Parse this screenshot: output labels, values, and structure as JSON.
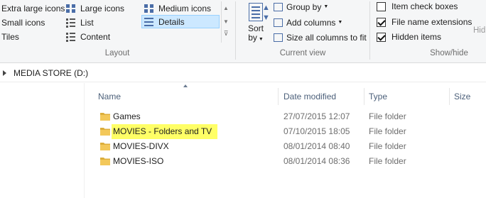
{
  "ribbon": {
    "layout": {
      "label": "Layout",
      "items": [
        {
          "label": "Extra large icons",
          "icon": "extra-large-icons-icon"
        },
        {
          "label": "Large icons",
          "icon": "large-icons-icon"
        },
        {
          "label": "Medium icons",
          "icon": "medium-icons-icon"
        },
        {
          "label": "Small icons",
          "icon": "small-icons-icon"
        },
        {
          "label": "List",
          "icon": "list-icon"
        },
        {
          "label": "Details",
          "icon": "details-icon",
          "selected": true
        },
        {
          "label": "Tiles",
          "icon": "tiles-icon"
        },
        {
          "label": "Content",
          "icon": "content-icon"
        }
      ]
    },
    "current_view": {
      "label": "Current view",
      "sort_by_line1": "Sort",
      "sort_by_line2": "by",
      "group_by": "Group by",
      "add_columns": "Add columns",
      "size_all_columns": "Size all columns to fit"
    },
    "show_hide": {
      "label": "Show/hide",
      "item_check_boxes": {
        "label": "Item check boxes",
        "checked": false
      },
      "file_name_extensions": {
        "label": "File name extensions",
        "checked": true
      },
      "hidden_items": {
        "label": "Hidden items",
        "checked": true
      },
      "hide_truncated": "Hid"
    }
  },
  "address": {
    "path": "MEDIA STORE (D:)"
  },
  "columns": {
    "name": "Name",
    "date_modified": "Date modified",
    "type": "Type",
    "size": "Size"
  },
  "files": [
    {
      "name": "Games",
      "date": "27/07/2015 12:07",
      "type": "File folder",
      "highlighted": false
    },
    {
      "name": "MOVIES - Folders and TV",
      "date": "07/10/2015 18:05",
      "type": "File folder",
      "highlighted": true
    },
    {
      "name": "MOVIES-DIVX",
      "date": "08/01/2014 08:40",
      "type": "File folder",
      "highlighted": false
    },
    {
      "name": "MOVIES-ISO",
      "date": "08/01/2014 08:36",
      "type": "File folder",
      "highlighted": false
    }
  ],
  "colors": {
    "highlight": "#ffff66",
    "selection": "#cce8ff",
    "folder": "#f0c14b",
    "header_text": "#4c607a"
  }
}
